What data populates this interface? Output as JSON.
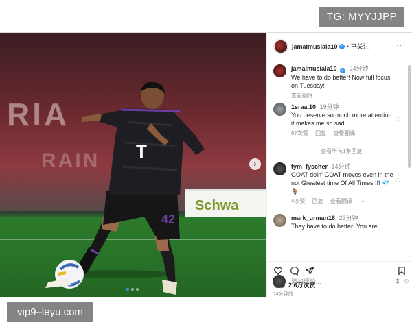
{
  "watermarks": {
    "top": "TG: MYYJJPP",
    "bottom": "vip9–leyu.com"
  },
  "photo": {
    "banner_text": "RIA",
    "banner_text2": "RAIN",
    "ad_board_text": "Schwa",
    "next_button_icon": "chevron-right-icon",
    "slide_count": 3,
    "active_slide": 0
  },
  "header": {
    "username": "jamalmusiala10",
    "separator": "•",
    "follow_status": "已关注",
    "more_label": "···"
  },
  "comments": [
    {
      "username": "jamalmusiala10",
      "verified": true,
      "time": "24分钟",
      "text": "We have to do better! Now full focus on Tuesday!",
      "meta": [
        "查看翻译"
      ],
      "avatar_color": "#7a1c22"
    },
    {
      "username": "1sraa.10",
      "verified": false,
      "time": "19分钟",
      "text": "You deserve so much more attention it makes me so sad",
      "meta": [
        "67次赞",
        "回复",
        "查看翻译"
      ],
      "replies": "查看所有1条回复",
      "avatar_color": "#6c6f72"
    },
    {
      "username": "tym_fyscher",
      "verified": false,
      "time": "14分钟",
      "text": "GOAT doin' GOAT moves even in the not Greatest time Of All Times !!! 💎🐐",
      "meta": [
        "4次赞",
        "回复",
        "查看翻译",
        "···"
      ],
      "avatar_color": "#2b2b2b"
    },
    {
      "username": "mark_urman18",
      "verified": false,
      "time": "23分钟",
      "text": "They have to do better! You are",
      "meta": [],
      "avatar_color": "#8a7a6a"
    }
  ],
  "actions": {
    "likes": "2.6万次赞",
    "date": "24分钟前"
  },
  "add_comment": {
    "placeholder": "添加评论..."
  },
  "colors": {
    "accent": "#3897f0",
    "muted_text": "#8e8e8e"
  }
}
